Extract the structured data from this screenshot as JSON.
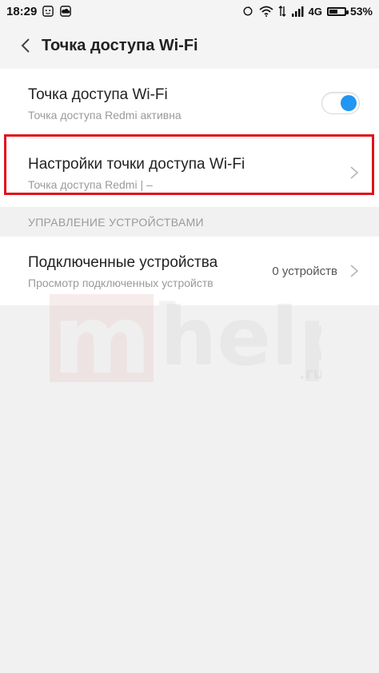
{
  "status_bar": {
    "time": "18:29",
    "network": "4G",
    "battery": "53%",
    "battery_level": 0.53
  },
  "app_bar": {
    "title": "Точка доступа Wi-Fi"
  },
  "hotspot": {
    "title": "Точка доступа Wi-Fi",
    "subtitle": "Точка доступа Redmi активна",
    "enabled": true
  },
  "hotspot_settings": {
    "title": "Настройки точки доступа Wi-Fi",
    "subtitle": "Точка доступа Redmi | –"
  },
  "device_section": {
    "header": "УПРАВЛЕНИЕ УСТРОЙСТВАМИ"
  },
  "connected_devices": {
    "title": "Подключенные устройства",
    "subtitle": "Просмотр подключенных устройств",
    "count": "0 устройств"
  },
  "watermark": {
    "text_main": "help",
    "text_tld": ".ru"
  },
  "colors": {
    "accent": "#2196f3",
    "highlight": "#e0121a",
    "background": "#f1f1f1"
  }
}
